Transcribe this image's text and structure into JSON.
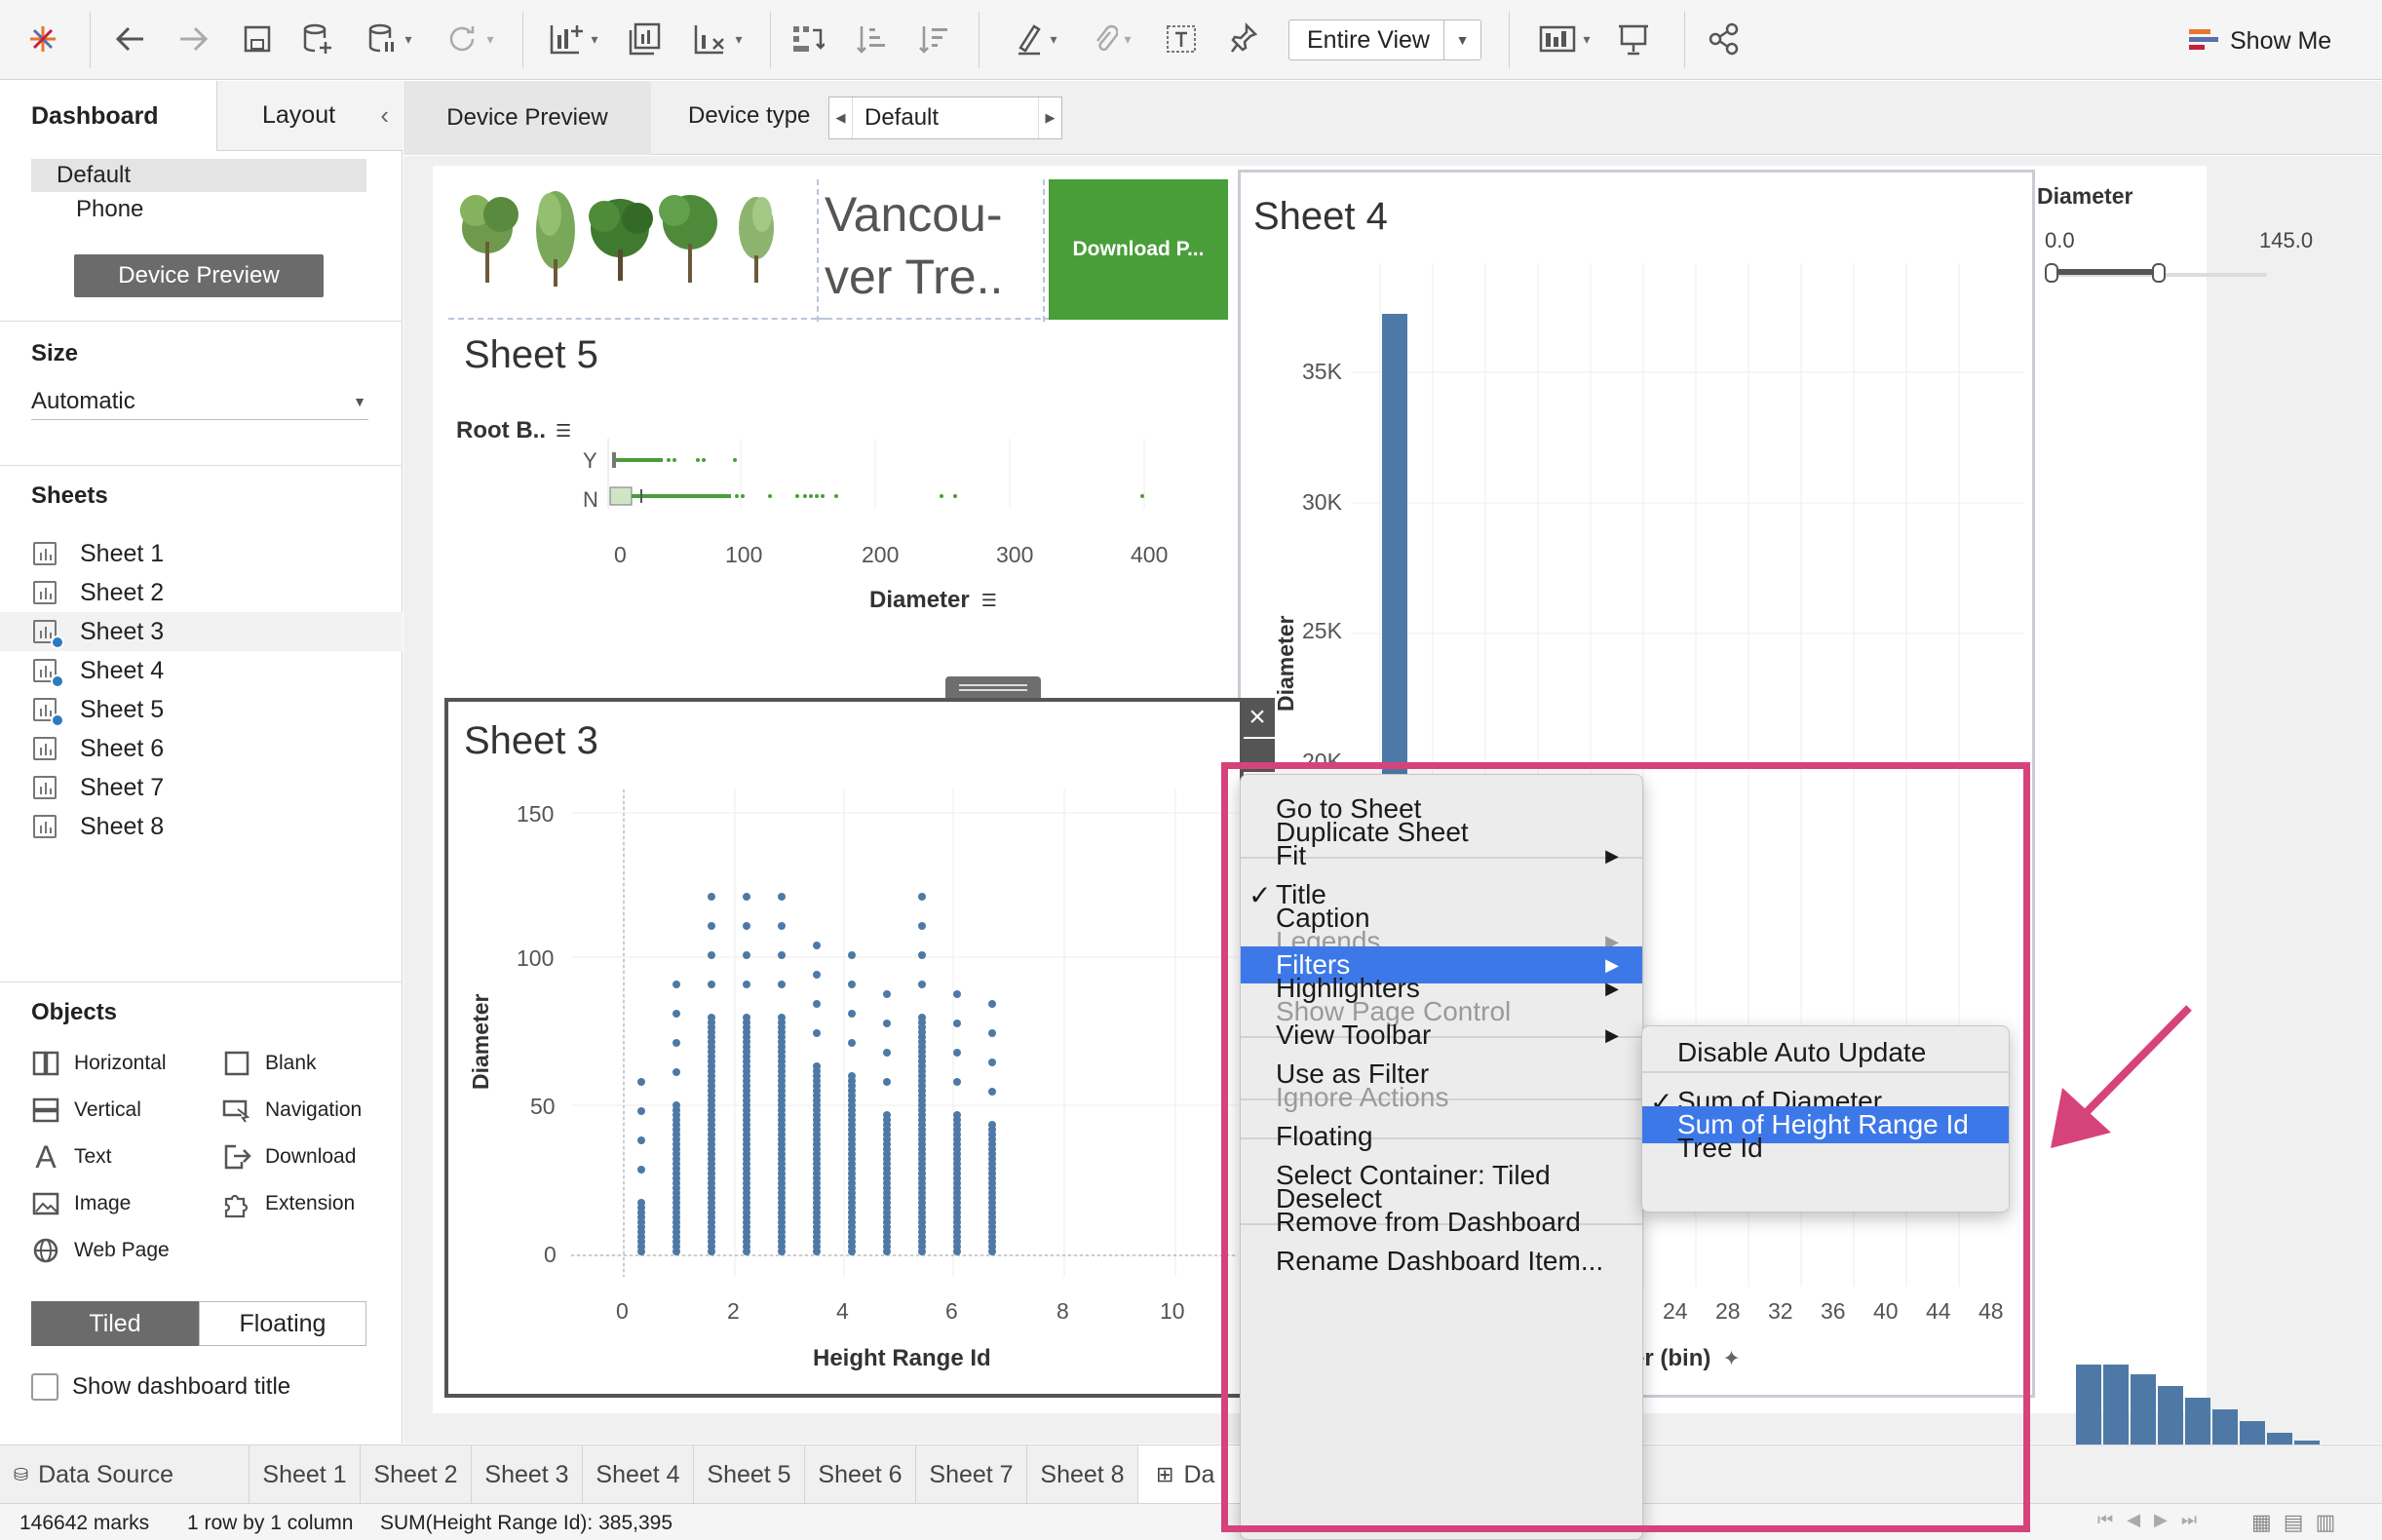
{
  "toolbar": {
    "view_select": "Entire View",
    "show_me_label": "Show Me"
  },
  "left_panel": {
    "tabs": [
      "Dashboard",
      "Layout"
    ],
    "device_options": [
      "Default",
      "Phone"
    ],
    "device_preview_button": "Device Preview",
    "size_header": "Size",
    "size_value": "Automatic",
    "sheets_header": "Sheets",
    "sheets": [
      "Sheet 1",
      "Sheet 2",
      "Sheet 3",
      "Sheet 4",
      "Sheet 5",
      "Sheet 6",
      "Sheet 7",
      "Sheet 8"
    ],
    "objects_header": "Objects",
    "objects": [
      "Horizontal",
      "Blank",
      "Vertical",
      "Navigation",
      "Text",
      "Download",
      "Image",
      "Extension",
      "Web Page"
    ],
    "tiled_label": "Tiled",
    "floating_label": "Floating",
    "show_title_label": "Show dashboard title"
  },
  "device_bar": {
    "preview_label": "Device Preview",
    "device_type_label": "Device type",
    "device_type_value": "Default"
  },
  "dashboard": {
    "title_text": "Vancou-\nver Tre..",
    "download_button": "Download P...",
    "diameter_filter": {
      "title": "Diameter",
      "min": "0.0",
      "max": "145.0"
    },
    "sheet5": {
      "title": "Sheet 5",
      "row_header": "Root B..",
      "rows": [
        "Y",
        "N"
      ],
      "ticks": [
        "0",
        "100",
        "200",
        "300",
        "400"
      ],
      "x_title": "Diameter"
    },
    "sheet4": {
      "title": "Sheet 4",
      "y_ticks": [
        "35K",
        "30K",
        "25K",
        "20K"
      ],
      "y_title": "Diameter",
      "x_ticks": [
        "24",
        "28",
        "32",
        "36",
        "40",
        "44",
        "48"
      ],
      "x_title": "Diameter (bin)"
    },
    "sheet3": {
      "title": "Sheet 3",
      "y_ticks": [
        "150",
        "100",
        "50",
        "0"
      ],
      "x_ticks": [
        "0",
        "2",
        "4",
        "6",
        "8",
        "10"
      ],
      "x_title": "Height Range Id",
      "y_title": "Diameter"
    }
  },
  "context_menu": {
    "items": [
      {
        "label": "Go to Sheet",
        "state": "normal"
      },
      {
        "label": "Duplicate Sheet",
        "state": "normal"
      },
      {
        "label": "Fit",
        "state": "normal",
        "submenu": true
      },
      {
        "label": "Title",
        "state": "checked"
      },
      {
        "label": "Caption",
        "state": "normal"
      },
      {
        "label": "Legends",
        "state": "disabled",
        "submenu": true
      },
      {
        "label": "Filters",
        "state": "highlighted",
        "submenu": true
      },
      {
        "label": "Highlighters",
        "state": "normal",
        "submenu": true
      },
      {
        "label": "Show Page Control",
        "state": "disabled"
      },
      {
        "label": "View Toolbar",
        "state": "normal",
        "submenu": true
      },
      {
        "label": "Use as Filter",
        "state": "normal"
      },
      {
        "label": "Ignore Actions",
        "state": "disabled"
      },
      {
        "label": "Floating",
        "state": "normal"
      },
      {
        "label": "Select Container: Tiled",
        "state": "normal"
      },
      {
        "label": "Deselect",
        "state": "normal"
      },
      {
        "label": "Remove from Dashboard",
        "state": "normal"
      },
      {
        "label": "Rename Dashboard Item...",
        "state": "normal"
      }
    ]
  },
  "filters_submenu": {
    "items": [
      {
        "label": "Disable Auto Update",
        "state": "normal"
      },
      {
        "label": "Sum of Diameter",
        "state": "checked"
      },
      {
        "label": "Sum of Height Range Id",
        "state": "highlighted"
      },
      {
        "label": "Tree Id",
        "state": "normal"
      }
    ]
  },
  "bottom_tabs": [
    "Data Source",
    "Sheet 1",
    "Sheet 2",
    "Sheet 3",
    "Sheet 4",
    "Sheet 5",
    "Sheet 6",
    "Sheet 7",
    "Sheet 8",
    "Da"
  ],
  "status_bar": {
    "marks": "146642 marks",
    "layout": "1 row by 1 column",
    "sum": "SUM(Height Range Id): 385,395"
  },
  "colors": {
    "accent_blue": "#4e79a7",
    "menu_highlight": "#3d78e8",
    "annotation": "#d6437a",
    "download_green": "#4a9e3a"
  }
}
